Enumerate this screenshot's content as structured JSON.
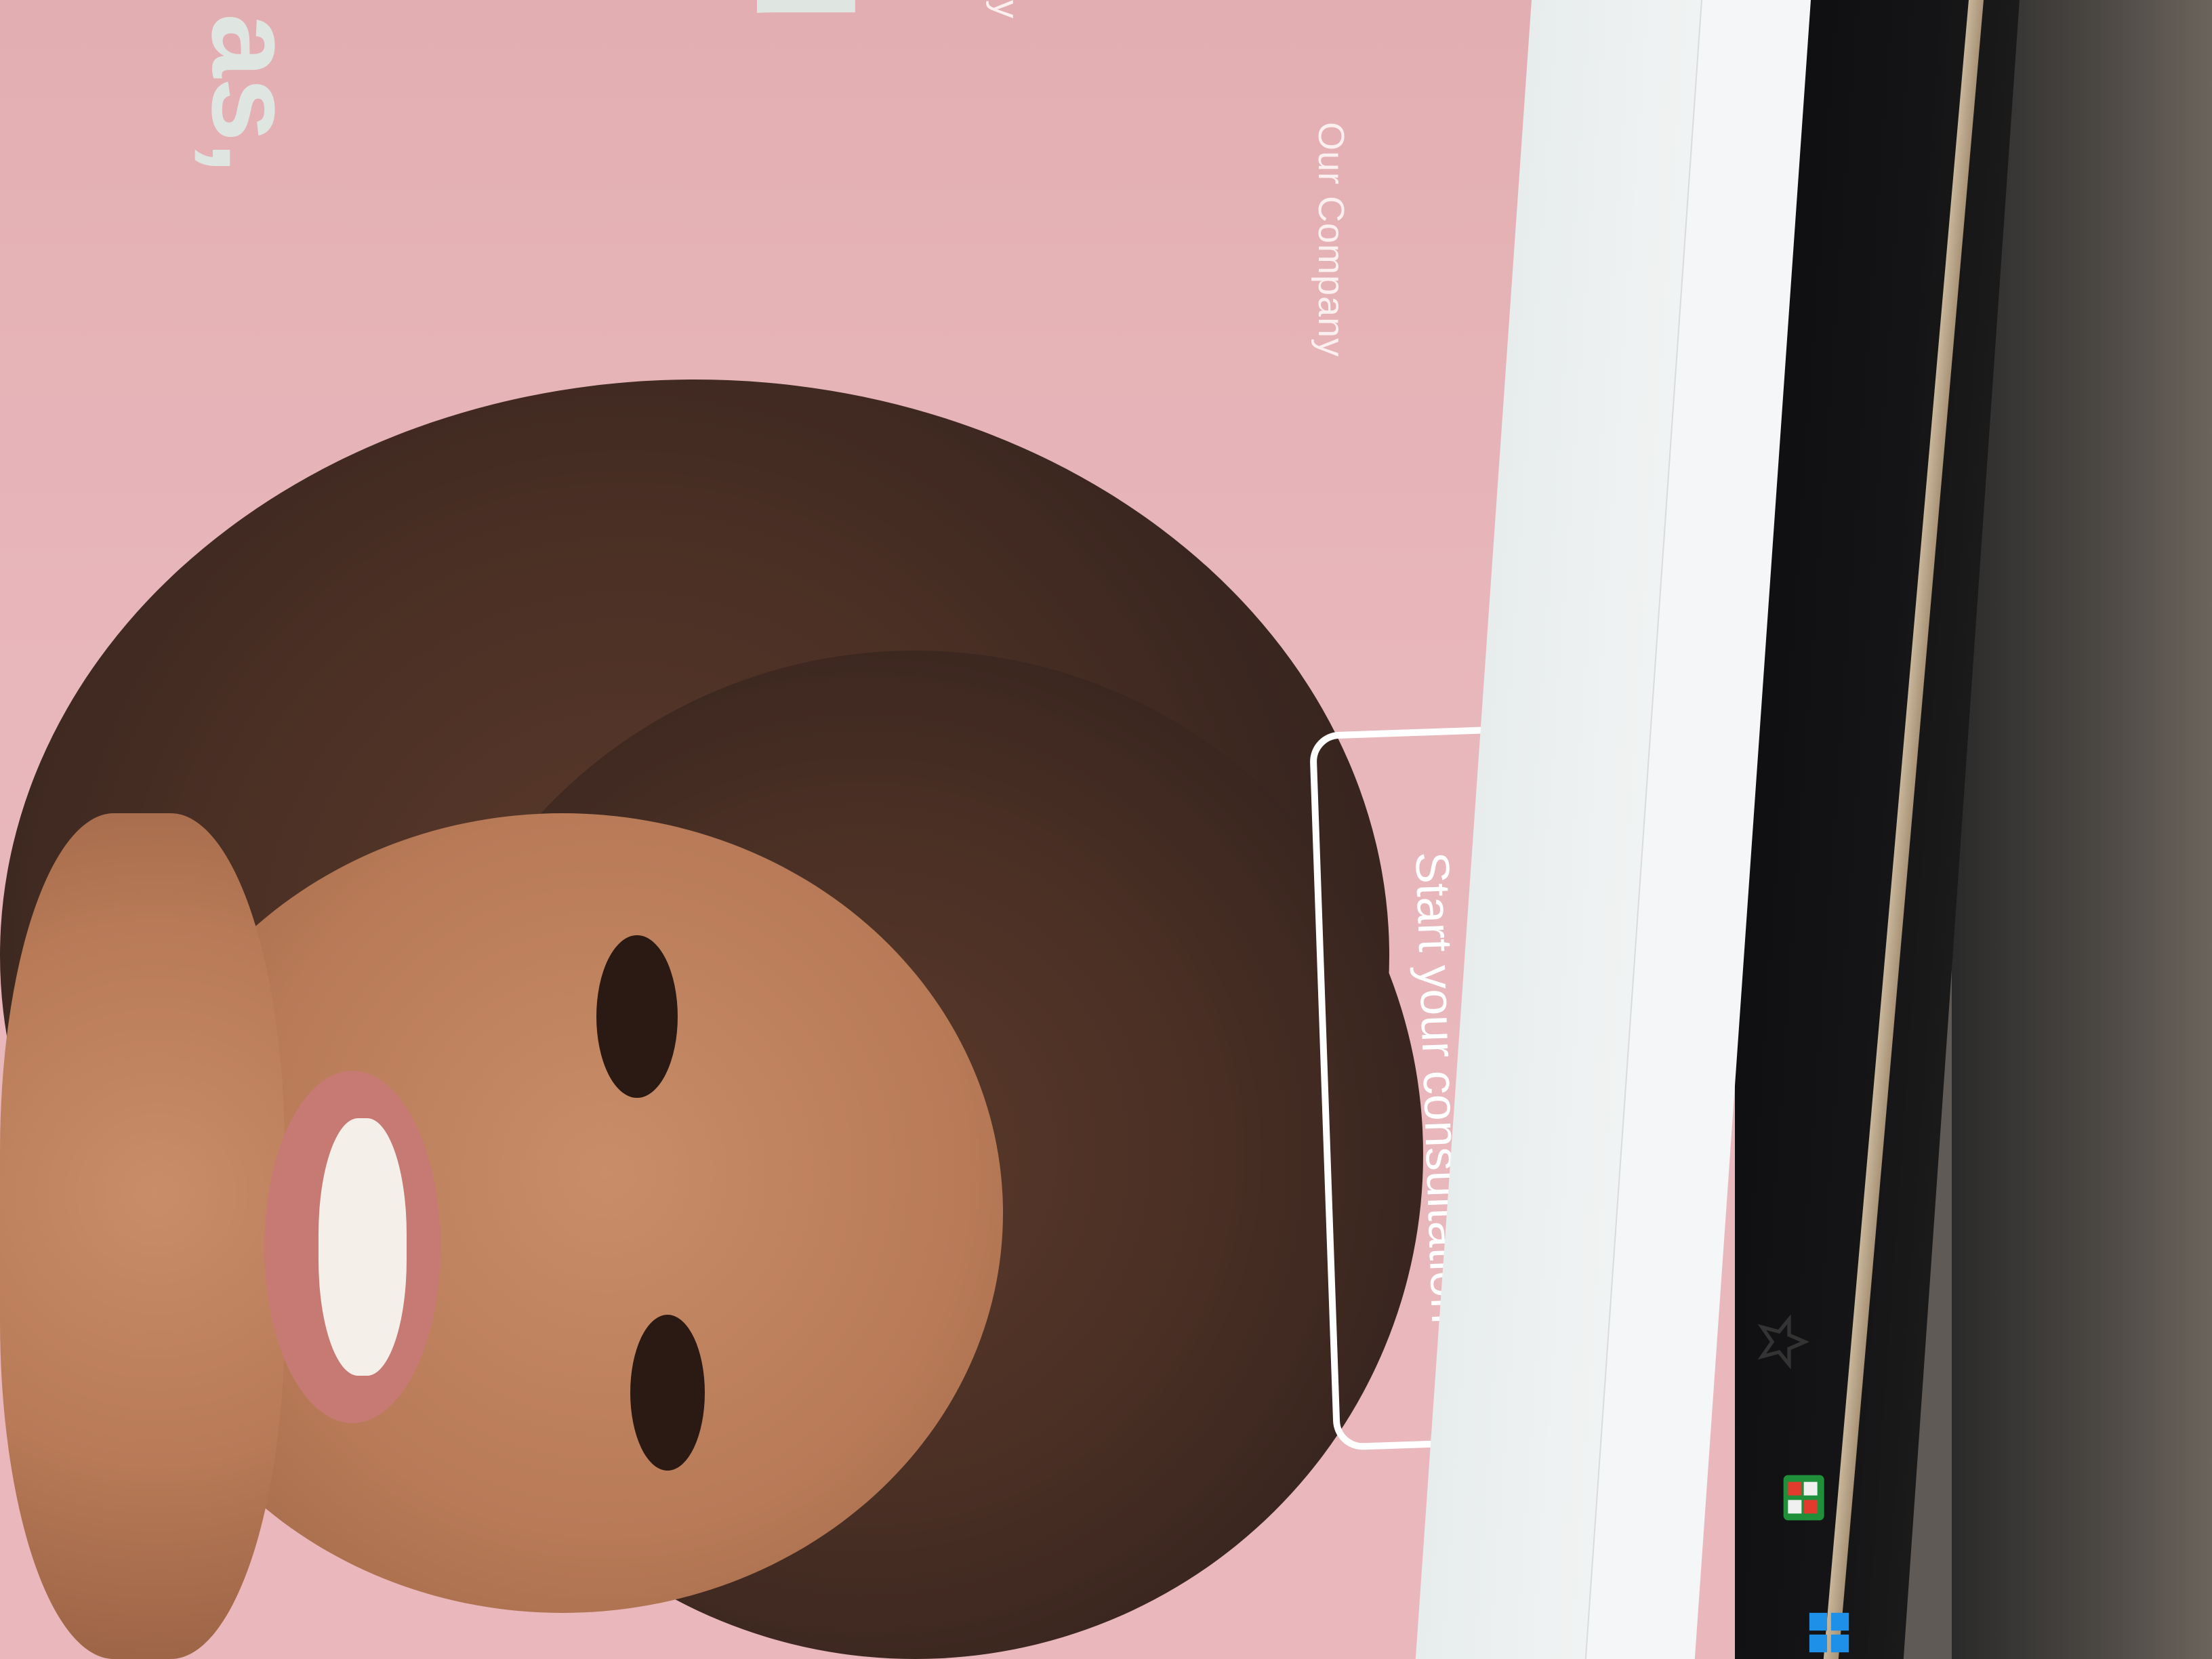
{
  "page": {
    "headline_fragment": "as,",
    "headline_fragment_2": "d",
    "nav": {
      "prev_item": "y",
      "our_company": "Our Company"
    },
    "cta_label": "Start your consultation"
  },
  "browser": {
    "bookmark_icon": "star-icon",
    "taskbar_icons": [
      "store-icon",
      "windows-start-icon"
    ]
  },
  "colors": {
    "hero_background": "#e8b5b9",
    "cta_border": "#ffffff",
    "headline": "#dfece7"
  }
}
